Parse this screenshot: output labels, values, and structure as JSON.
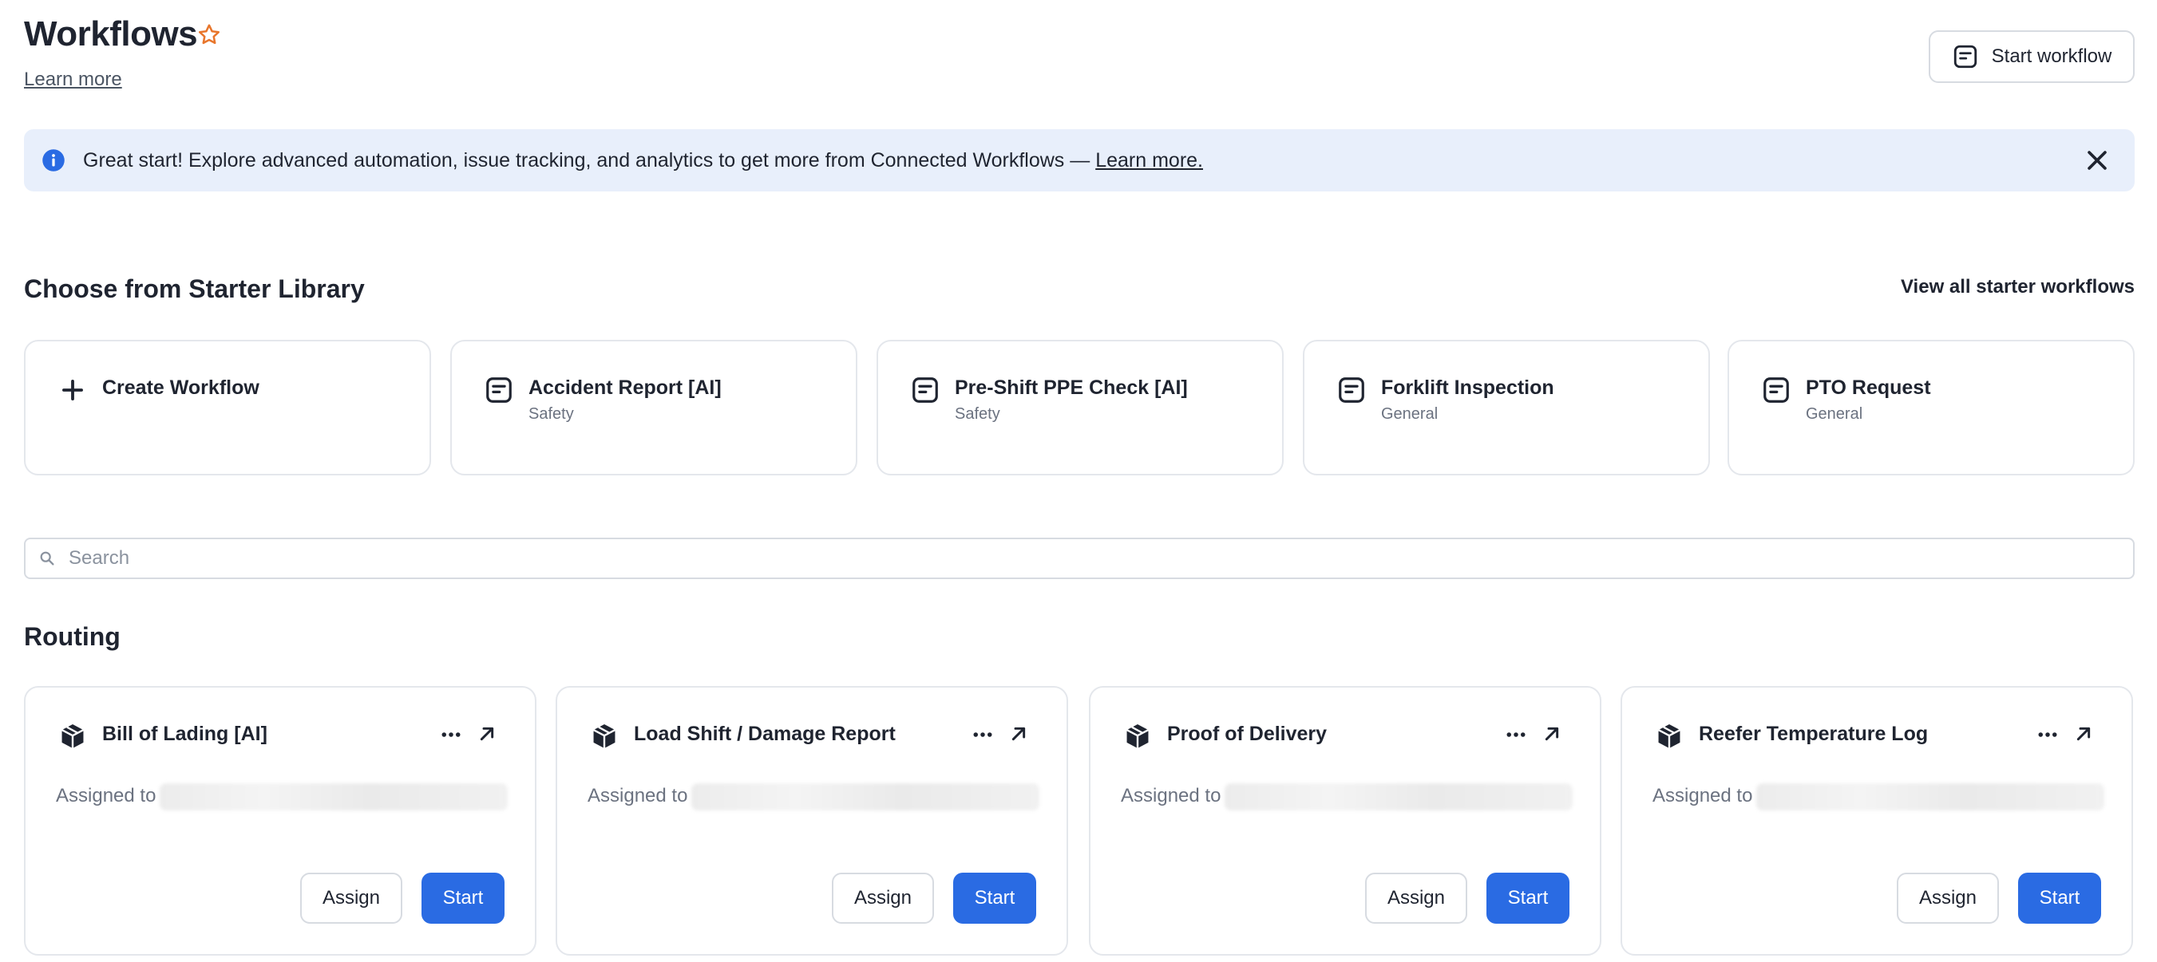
{
  "header": {
    "title": "Workflows",
    "learn_more": "Learn more",
    "start_workflow": "Start workflow"
  },
  "banner": {
    "text": "Great start! Explore advanced automation, issue tracking, and analytics to get more from Connected Workflows — ",
    "link": "Learn more."
  },
  "starter": {
    "title": "Choose from Starter Library",
    "view_all": "View all starter workflows",
    "cards": [
      {
        "name": "Create Workflow",
        "category": "",
        "icon": "plus-icon"
      },
      {
        "name": "Accident Report [AI]",
        "category": "Safety",
        "icon": "form-icon"
      },
      {
        "name": "Pre-Shift PPE Check [AI]",
        "category": "Safety",
        "icon": "form-icon"
      },
      {
        "name": "Forklift Inspection",
        "category": "General",
        "icon": "form-icon"
      },
      {
        "name": "PTO Request",
        "category": "General",
        "icon": "form-icon"
      }
    ]
  },
  "search": {
    "placeholder": "Search",
    "value": ""
  },
  "routing": {
    "title": "Routing",
    "cards": [
      {
        "name": "Bill of Lading [AI]",
        "assigned_label": "Assigned to",
        "assign": "Assign",
        "start": "Start",
        "icon": "package-icon"
      },
      {
        "name": "Load Shift / Damage Report",
        "assigned_label": "Assigned to",
        "assign": "Assign",
        "start": "Start",
        "icon": "package-icon"
      },
      {
        "name": "Proof of Delivery",
        "assigned_label": "Assigned to",
        "assign": "Assign",
        "start": "Start",
        "icon": "package-icon"
      },
      {
        "name": "Reefer Temperature Log",
        "assigned_label": "Assigned to",
        "assign": "Assign",
        "start": "Start",
        "icon": "package-icon"
      }
    ]
  },
  "colors": {
    "primary": "#2a6be3",
    "star": "#e8762c",
    "banner_bg": "#e8effb",
    "info_icon": "#2a6be3",
    "text": "#1f2430",
    "muted": "#6b7280"
  }
}
